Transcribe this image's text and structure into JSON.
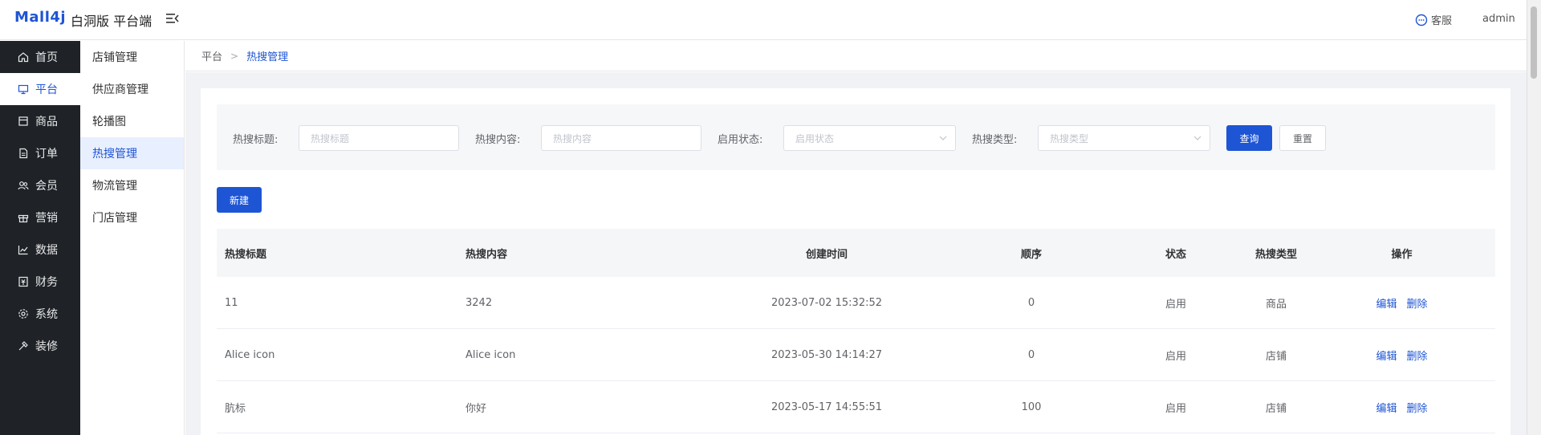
{
  "header": {
    "logo": "Mall4j",
    "subtitle": "白洞版 平台端",
    "customer_service": "客服",
    "user": "admin"
  },
  "sidebar": {
    "items": [
      {
        "label": "首页",
        "icon": "home-icon"
      },
      {
        "label": "平台",
        "icon": "monitor-icon"
      },
      {
        "label": "商品",
        "icon": "box-icon"
      },
      {
        "label": "订单",
        "icon": "document-icon"
      },
      {
        "label": "会员",
        "icon": "users-icon"
      },
      {
        "label": "营销",
        "icon": "gift-icon"
      },
      {
        "label": "数据",
        "icon": "chart-icon"
      },
      {
        "label": "财务",
        "icon": "finance-icon"
      },
      {
        "label": "系统",
        "icon": "settings-icon"
      },
      {
        "label": "装修",
        "icon": "decorate-icon"
      }
    ],
    "active_index": 1
  },
  "subsidebar": {
    "items": [
      "店铺管理",
      "供应商管理",
      "轮播图",
      "热搜管理",
      "物流管理",
      "门店管理"
    ],
    "active_index": 3
  },
  "breadcrumb": {
    "root": "平台",
    "current": "热搜管理"
  },
  "search": {
    "title_label": "热搜标题:",
    "title_placeholder": "热搜标题",
    "content_label": "热搜内容:",
    "content_placeholder": "热搜内容",
    "status_label": "启用状态:",
    "status_placeholder": "启用状态",
    "type_label": "热搜类型:",
    "type_placeholder": "热搜类型",
    "query_button": "查询",
    "reset_button": "重置"
  },
  "actions": {
    "new_button": "新建"
  },
  "table": {
    "headers": [
      "热搜标题",
      "热搜内容",
      "创建时间",
      "顺序",
      "状态",
      "热搜类型",
      "操作"
    ],
    "edit_label": "编辑",
    "delete_label": "删除",
    "rows": [
      {
        "title": "11",
        "content": "3242",
        "created": "2023-07-02 15:32:52",
        "order": "0",
        "status": "启用",
        "type": "商品"
      },
      {
        "title": "Alice icon",
        "content": "Alice icon",
        "created": "2023-05-30 14:14:27",
        "order": "0",
        "status": "启用",
        "type": "店铺"
      },
      {
        "title": "肮标",
        "content": "你好",
        "created": "2023-05-17 14:55:51",
        "order": "100",
        "status": "启用",
        "type": "店铺"
      }
    ]
  }
}
